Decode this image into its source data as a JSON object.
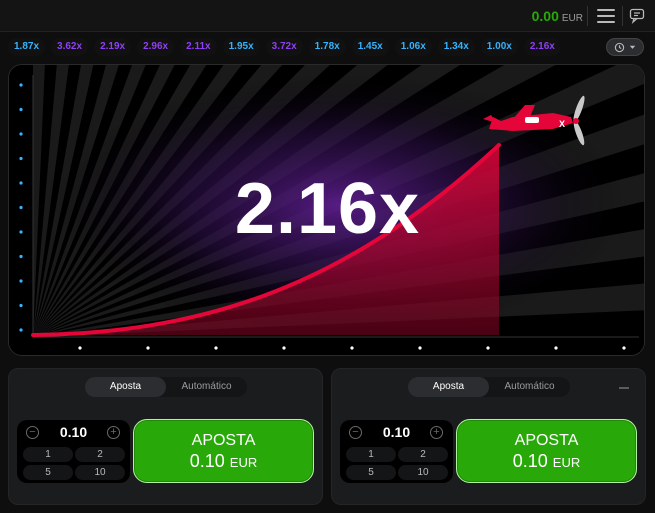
{
  "header": {
    "balance_amount": "0.00",
    "balance_currency": "EUR",
    "menu_icon": "hamburger-menu-icon",
    "chat_icon": "chat-icon"
  },
  "history": {
    "multipliers": [
      {
        "value": "1.87x",
        "color": "blue"
      },
      {
        "value": "3.62x",
        "color": "purple"
      },
      {
        "value": "2.19x",
        "color": "purple"
      },
      {
        "value": "2.96x",
        "color": "purple"
      },
      {
        "value": "2.11x",
        "color": "purple"
      },
      {
        "value": "1.95x",
        "color": "blue"
      },
      {
        "value": "3.72x",
        "color": "purple"
      },
      {
        "value": "1.78x",
        "color": "blue"
      },
      {
        "value": "1.45x",
        "color": "blue"
      },
      {
        "value": "1.06x",
        "color": "blue"
      },
      {
        "value": "1.34x",
        "color": "blue"
      },
      {
        "value": "1.00x",
        "color": "blue"
      },
      {
        "value": "2.16x",
        "color": "purple"
      }
    ],
    "history_button_icons": [
      "clock-history-icon",
      "chevron-down-icon"
    ]
  },
  "game": {
    "current_multiplier": "2.16x",
    "curve_color": "#e50539",
    "plane_color": "#e50539",
    "background_glow": "#5a1c8a"
  },
  "bet_panels": [
    {
      "tabs": [
        "Aposta",
        "Automático"
      ],
      "active_tab": "Aposta",
      "stake": "0.10",
      "quick_amounts": [
        "1",
        "2",
        "5",
        "10"
      ],
      "bet_label": "APOSTA",
      "bet_amount": "0.10",
      "bet_currency": "EUR"
    },
    {
      "tabs": [
        "Aposta",
        "Automático"
      ],
      "active_tab": "Aposta",
      "stake": "0.10",
      "quick_amounts": [
        "1",
        "2",
        "5",
        "10"
      ],
      "bet_label": "APOSTA",
      "bet_amount": "0.10",
      "bet_currency": "EUR"
    }
  ],
  "colors": {
    "accent_green": "#28a909",
    "multiplier_blue": "#34b4ff",
    "multiplier_purple": "#913ef8",
    "panel_bg": "#1b1c1d"
  }
}
